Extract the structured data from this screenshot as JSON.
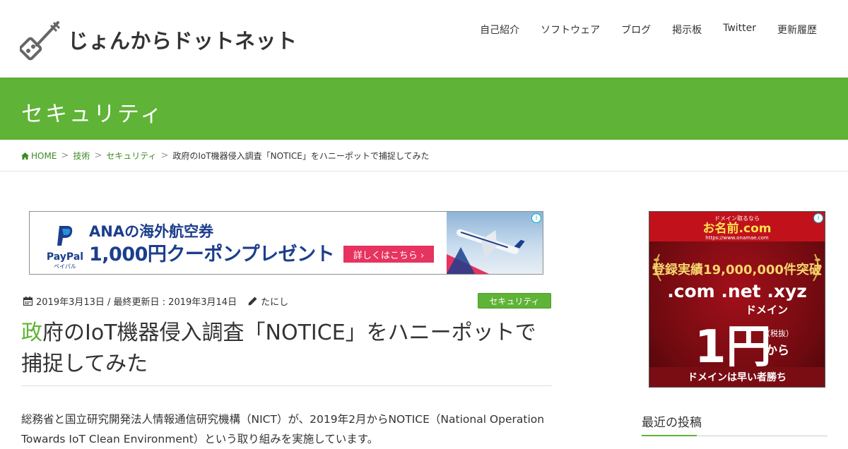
{
  "site": {
    "name": "じょんからドットネット"
  },
  "nav": [
    {
      "label": "自己紹介"
    },
    {
      "label": "ソフトウェア"
    },
    {
      "label": "ブログ"
    },
    {
      "label": "掲示板"
    },
    {
      "label": "Twitter"
    },
    {
      "label": "更新履歴"
    }
  ],
  "category_header": {
    "title": "セキュリティ"
  },
  "breadcrumb": {
    "home": "HOME",
    "items": [
      "技術",
      "セキュリティ"
    ],
    "current": "政府のIoT機器侵入調査「NOTICE」をハニーポットで捕捉してみた",
    "separator": ">"
  },
  "ad_left": {
    "brand": "PayPal",
    "brand_sub": "ペイパル",
    "line1": "ANAの海外航空券",
    "line2": "1,000円クーポンプレゼント",
    "button": "詳しくはこちら ›",
    "info": "i"
  },
  "post": {
    "date": "2019年3月13日 / 最終更新日 : 2019年3月14日",
    "author": "たにし",
    "category": "セキュリティ",
    "title_first": "政",
    "title_rest": "府のIoT機器侵入調査「NOTICE」をハニーポットで捕捉してみた",
    "body": "総務省と国立研究開発法人情報通信研究機構（NICT）が、2019年2月からNOTICE（National Operation Towards IoT Clean Environment）という取り組みを実施しています。"
  },
  "ad_right": {
    "top_small": "ドメイン取るなら",
    "brand": "お名前.com",
    "url": "https://www.onamae.com",
    "record": "登録実績19,000,000件突破",
    "tlds": ".com .net .xyz",
    "domain": "ドメイン",
    "price": "1円",
    "tax": "（税抜）",
    "kara": "から",
    "bottom": "ドメインは早い者勝ち",
    "info": "i"
  },
  "sidebar": {
    "recent_heading": "最近の投稿"
  },
  "colors": {
    "accent": "#5fb336",
    "link": "#3b8a23",
    "ad_blue": "#1c3e8c",
    "ad_pink": "#e6335f",
    "ad_red": "#c1121c"
  }
}
